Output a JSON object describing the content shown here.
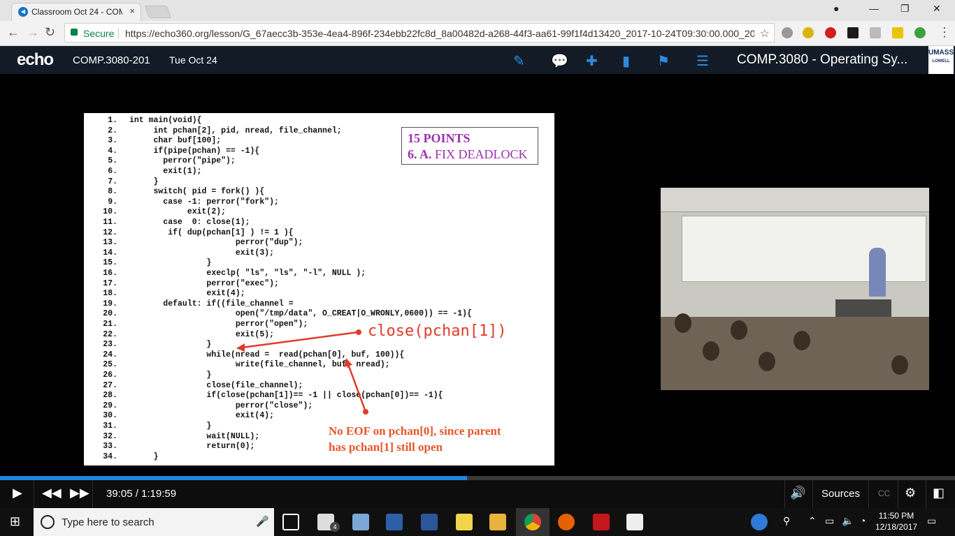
{
  "browser": {
    "tab_title": "Classroom Oct 24 - COM",
    "tab_close": "×",
    "url": "https://echo360.org/lesson/G_67aecc3b-353e-4ea4-896f-234ebb22fc8d_8a00482d-a268-44f3-aa61-99f1f4d13420_2017-10-24T09:30:00.000_20...",
    "secure_label": "Secure"
  },
  "echo": {
    "logo": "echo",
    "course_code": "COMP.3080-201",
    "date": "Tue Oct 24",
    "course_title": "COMP.3080 - Operating Sy...",
    "umass_top": "UMASS",
    "umass_bottom": "LOWELL"
  },
  "slide": {
    "points_line1": "15 POINTS",
    "points_line2_prefix": "6. A.",
    "points_line2_rest": "FIX DEADLOCK",
    "annotation_close": "close(pchan[1])",
    "annotation_note_line1": "No EOF on pchan[0], since parent",
    "annotation_note_line2": "has pchan[1] still open",
    "code": [
      {
        "n": "1.",
        "t": "int main(void){"
      },
      {
        "n": "2.",
        "t": "     int pchan[2], pid, nread, file_channel;"
      },
      {
        "n": "3.",
        "t": "     char buf[100];"
      },
      {
        "n": "4.",
        "t": "     if(pipe(pchan) == -1){"
      },
      {
        "n": "5.",
        "t": "       perror(\"pipe\");"
      },
      {
        "n": "6.",
        "t": "       exit(1);"
      },
      {
        "n": "7.",
        "t": "     }"
      },
      {
        "n": "8.",
        "t": "     switch( pid = fork() ){"
      },
      {
        "n": "9.",
        "t": "       case -1: perror(\"fork\");"
      },
      {
        "n": "10.",
        "t": "            exit(2);"
      },
      {
        "n": "11.",
        "t": "       case  0: close(1);"
      },
      {
        "n": "12.",
        "t": "        if( dup(pchan[1] ) != 1 ){"
      },
      {
        "n": "13.",
        "t": "                      perror(\"dup\");"
      },
      {
        "n": "14.",
        "t": "                      exit(3);"
      },
      {
        "n": "15.",
        "t": "                }"
      },
      {
        "n": "16.",
        "t": "                execlp( \"ls\", \"ls\", \"-l\", NULL );"
      },
      {
        "n": "17.",
        "t": "                perror(\"exec\");"
      },
      {
        "n": "18.",
        "t": "                exit(4);"
      },
      {
        "n": "19.",
        "t": "       default: if((file_channel ="
      },
      {
        "n": "20.",
        "t": "                      open(\"/tmp/data\", O_CREAT|O_WRONLY,0600)) == -1){"
      },
      {
        "n": "21.",
        "t": "                      perror(\"open\");"
      },
      {
        "n": "22.",
        "t": "                      exit(5);"
      },
      {
        "n": "23.",
        "t": "                }"
      },
      {
        "n": "24.",
        "t": "                while(nread =  read(pchan[0], buf, 100)){"
      },
      {
        "n": "25.",
        "t": "                      write(file_channel, buf, nread);"
      },
      {
        "n": "26.",
        "t": "                }"
      },
      {
        "n": "27.",
        "t": "                close(file_channel);"
      },
      {
        "n": "28.",
        "t": "                if(close(pchan[1])== -1 || close(pchan[0])== -1){"
      },
      {
        "n": "29.",
        "t": "                      perror(\"close\");"
      },
      {
        "n": "30.",
        "t": "                      exit(4);"
      },
      {
        "n": "31.",
        "t": "                }"
      },
      {
        "n": "32.",
        "t": "                wait(NULL);"
      },
      {
        "n": "33.",
        "t": "                return(0);"
      },
      {
        "n": "34.",
        "t": "     }"
      }
    ]
  },
  "player": {
    "time": "39:05 / 1:19:59",
    "progress_fraction": 0.489,
    "sources_label": "Sources",
    "cc_label": "CC"
  },
  "taskbar": {
    "search_placeholder": "Type here to search",
    "clock_time": "11:50 PM",
    "clock_date": "12/18/2017",
    "mail_badge": "4"
  },
  "colors": {
    "echo_bar": "#131c26",
    "echo_accent": "#2d8ae3",
    "progress_fill": "#1f86e0",
    "annotation_red": "#e03b2a",
    "points_purple": "#9b2fae"
  }
}
